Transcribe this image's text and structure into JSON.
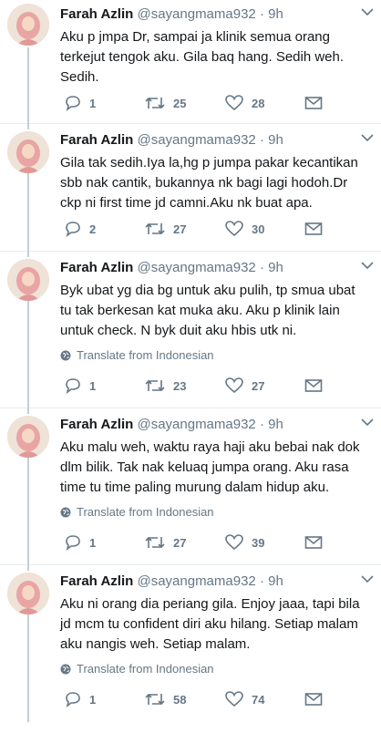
{
  "translate_label": "Translate from Indonesian",
  "colors": {
    "text": "#14171a",
    "secondary": "#657786",
    "thread_line": "#c4cfd6",
    "divider": "#e6ecf0"
  },
  "icons": [
    "reply-icon",
    "retweet-icon",
    "like-icon",
    "direct-message-icon",
    "globe-icon",
    "chevron-down-icon"
  ],
  "tweets": [
    {
      "name": "Farah Azlin",
      "handle": "@sayangmama932",
      "dot": "·",
      "time": "9h",
      "text": "Aku p jmpa Dr, sampai ja klinik semua orang\nterkejut tengok aku. Gila baq hang. Sedih weh.\nSedih.",
      "replies": "1",
      "retweets": "25",
      "likes": "28"
    },
    {
      "name": "Farah Azlin",
      "handle": "@sayangmama932",
      "dot": "·",
      "time": "9h",
      "text": "Gila tak sedih.Iya la,hg p jumpa pakar kecantikan\nsbb nak cantik, bukannya nk bagi lagi hodoh.Dr\nckp ni first time jd camni.Aku nk buat apa.",
      "replies": "2",
      "retweets": "27",
      "likes": "30"
    },
    {
      "name": "Farah Azlin",
      "handle": "@sayangmama932",
      "dot": "·",
      "time": "9h",
      "text": "Byk ubat yg dia bg untuk aku pulih, tp smua ubat\ntu tak berkesan kat muka aku. Aku p klinik lain\nuntuk check. N byk duit aku hbis utk ni.",
      "replies": "1",
      "retweets": "23",
      "likes": "27"
    },
    {
      "name": "Farah Azlin",
      "handle": "@sayangmama932",
      "dot": "·",
      "time": "9h",
      "text": "Aku malu weh, waktu raya haji aku bebai nak dok\ndlm bilik. Tak nak keluaq jumpa orang. Aku rasa\ntime tu time paling murung dalam hidup aku.",
      "replies": "1",
      "retweets": "27",
      "likes": "39"
    },
    {
      "name": "Farah Azlin",
      "handle": "@sayangmama932",
      "dot": "·",
      "time": "9h",
      "text": "Aku ni orang dia periang gila. Enjoy jaaa, tapi bila\njd mcm tu confident diri aku hilang. Setiap malam\naku nangis weh. Setiap malam.",
      "replies": "1",
      "retweets": "58",
      "likes": "74"
    }
  ]
}
